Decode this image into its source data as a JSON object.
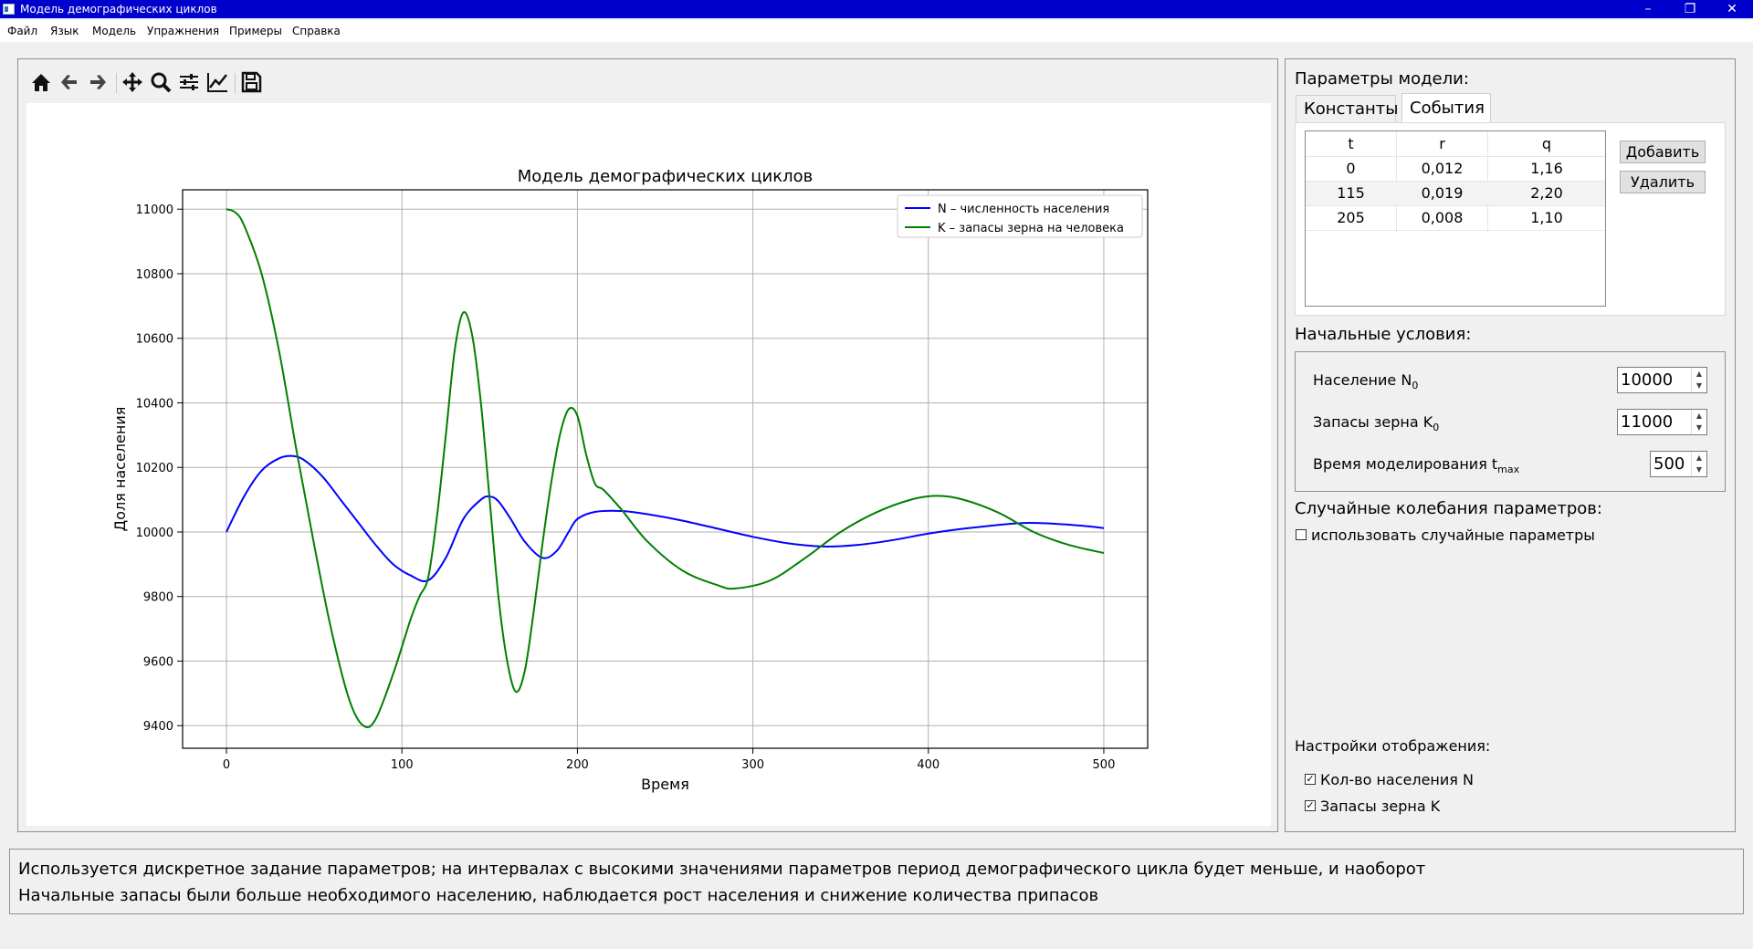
{
  "window": {
    "title": "Модель демографических циклов",
    "minimize": "–",
    "restore": "❐",
    "close": "✕"
  },
  "menu": [
    "Файл",
    "Язык",
    "Модель",
    "Упражнения",
    "Примеры",
    "Справка"
  ],
  "toolbar": {
    "icons": [
      "home-icon",
      "back-arrow-icon",
      "forward-arrow-icon",
      "pan-icon",
      "zoom-icon",
      "subplots-config-icon",
      "edit-axes-icon",
      "save-icon"
    ]
  },
  "chart_data": {
    "type": "line",
    "title": "Модель демографических циклов",
    "xlabel": "Время",
    "ylabel": "Доля населения",
    "xlim": [
      -25,
      525
    ],
    "ylim": [
      9330,
      11060
    ],
    "xticks": [
      0,
      100,
      200,
      300,
      400,
      500
    ],
    "yticks": [
      9400,
      9600,
      9800,
      10000,
      10200,
      10400,
      10600,
      10800,
      11000
    ],
    "grid": true,
    "legend_position": "top-right",
    "series": [
      {
        "name": "N – численность населения",
        "color": "#0000ff",
        "x": [
          0,
          10,
          20,
          30,
          38,
          45,
          55,
          65,
          75,
          85,
          95,
          105,
          115,
          125,
          135,
          145,
          150,
          155,
          162,
          170,
          180,
          188,
          195,
          200,
          210,
          225,
          240,
          260,
          280,
          300,
          320,
          340,
          360,
          380,
          400,
          420,
          440,
          455,
          470,
          490,
          500
        ],
        "y": [
          10000,
          10110,
          10190,
          10228,
          10235,
          10220,
          10170,
          10100,
          10030,
          9960,
          9900,
          9865,
          9850,
          9920,
          10040,
          10100,
          10110,
          10095,
          10040,
          9970,
          9920,
          9940,
          10000,
          10040,
          10062,
          10065,
          10055,
          10035,
          10010,
          9985,
          9965,
          9955,
          9960,
          9975,
          9995,
          10010,
          10022,
          10028,
          10026,
          10018,
          10012
        ]
      },
      {
        "name": "K – запасы зерна на человека",
        "color": "#008000",
        "x": [
          0,
          5,
          10,
          20,
          30,
          40,
          50,
          60,
          70,
          78,
          85,
          95,
          105,
          110,
          115,
          120,
          125,
          130,
          135,
          140,
          145,
          150,
          155,
          160,
          165,
          170,
          175,
          180,
          185,
          190,
          195,
          200,
          205,
          210,
          215,
          225,
          240,
          260,
          280,
          290,
          310,
          330,
          350,
          370,
          390,
          405,
          420,
          440,
          460,
          480,
          500
        ],
        "y": [
          11000,
          10990,
          10950,
          10800,
          10560,
          10250,
          9960,
          9690,
          9480,
          9400,
          9420,
          9560,
          9730,
          9800,
          9860,
          10050,
          10300,
          10560,
          10680,
          10610,
          10400,
          10100,
          9800,
          9600,
          9505,
          9570,
          9750,
          9960,
          10150,
          10300,
          10380,
          10360,
          10240,
          10150,
          10130,
          10070,
          9970,
          9880,
          9835,
          9825,
          9850,
          9920,
          10000,
          10060,
          10100,
          10112,
          10100,
          10060,
          10000,
          9960,
          9935
        ]
      }
    ]
  },
  "right_panel": {
    "model_params_label": "Параметры модели:",
    "tabs": [
      {
        "label": "Константы",
        "active": false
      },
      {
        "label": "События",
        "active": true
      }
    ],
    "events_table": {
      "headers": [
        "t",
        "r",
        "q"
      ],
      "rows": [
        [
          "0",
          "0,012",
          "1,16"
        ],
        [
          "115",
          "0,019",
          "2,20"
        ],
        [
          "205",
          "0,008",
          "1,10"
        ]
      ]
    },
    "add_button": "Добавить",
    "delete_button": "Удалить",
    "initial_conditions_label": "Начальные условия:",
    "population_label": "Население N",
    "population_sub": "0",
    "population_value": "10000",
    "grain_label": "Запасы зерна K",
    "grain_sub": "0",
    "grain_value": "11000",
    "time_label": "Время моделирования t",
    "time_sub": "max",
    "time_value": "500",
    "random_label": "Случайные колебания параметров:",
    "random_checkbox_label": "использовать случайные параметры",
    "random_checked": false,
    "display_settings_label": "Настройки отображения:",
    "show_population_label": "Кол-во населения N",
    "show_population_checked": true,
    "show_grain_label": "Запасы зерна K",
    "show_grain_checked": true
  },
  "status": {
    "line1": "Используется дискретное задание параметров; на интервалах с высокими значениями параметров период демографического цикла будет меньше, и наоборот",
    "line2": "Начальные запасы были больше необходимого населению, наблюдается рост населения и снижение количества припасов"
  }
}
